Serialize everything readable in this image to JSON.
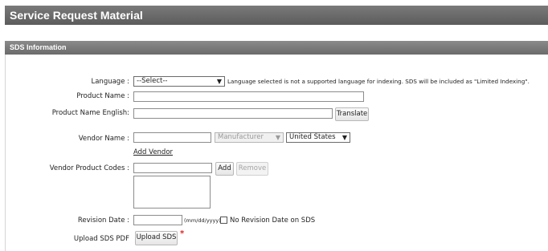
{
  "header": {
    "title": "Service Request Material"
  },
  "section": {
    "title": "SDS Information"
  },
  "form": {
    "language": {
      "label": "Language :",
      "selected": "--Select--",
      "note": "Language selected is not a supported language for indexing. SDS will be included as \"Limited Indexing\"."
    },
    "product_name": {
      "label": "Product Name :",
      "value": ""
    },
    "product_name_english": {
      "label": "Product Name English:",
      "value": "",
      "translate_label": "Translate"
    },
    "vendor_name": {
      "label": "Vendor Name :",
      "value": "",
      "role_selected": "Manufacturer",
      "country_selected": "United States",
      "add_vendor_label": "Add Vendor"
    },
    "vendor_product_codes": {
      "label": "Vendor Product Codes :",
      "value": "",
      "add_label": "Add",
      "remove_label": "Remove"
    },
    "revision_date": {
      "label": "Revision Date :",
      "value": "",
      "format_hint": "(mm/dd/yyyy)",
      "no_date_label": "No Revision Date on SDS",
      "no_date_checked": false
    },
    "upload_sds": {
      "label": "Upload SDS PDF",
      "button_label": "Upload SDS",
      "required_mark": "*"
    }
  },
  "colors": {
    "header_bg": "#666666",
    "section_bg": "#7a7a7a",
    "required": "#dd2222"
  }
}
